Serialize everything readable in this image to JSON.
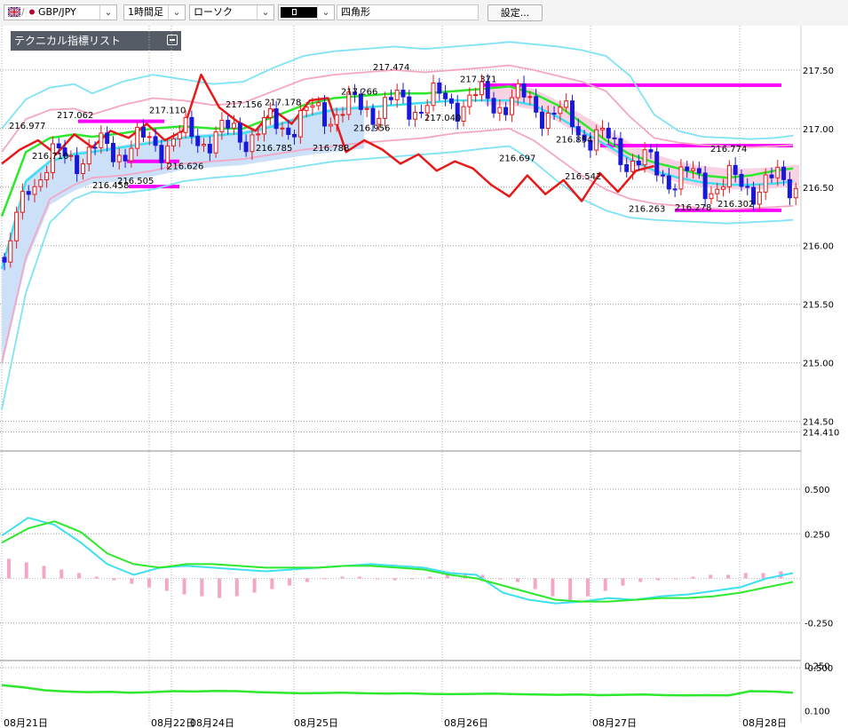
{
  "toolbar": {
    "symbol": "GBP/JPY",
    "timeframe": "1時間足",
    "chart_type": "ローソク",
    "drawing_tool": "四角形",
    "settings_button": "設定..."
  },
  "tech_panel": {
    "title": "テクニカル指標リスト"
  },
  "colors": {
    "bollinger_2": "#f4a6c6",
    "bollinger_3": "#7fe3f5",
    "ma_fast": "#3ee0f0",
    "ma_slow": "#2ee82e",
    "lagging": "#e81818",
    "cloud": "#cce0f8",
    "cloud_bear": "#f8c8dc",
    "level_lines": "#ff00ff",
    "candle_up": "#e81818",
    "candle_down": "#1818d8"
  },
  "chart_data": [
    {
      "type": "line",
      "panel": "price",
      "ylim": [
        214.3,
        217.62
      ],
      "y_ticks": [
        "217.50",
        "217.00",
        "216.50",
        "216.00",
        "215.50",
        "215.00",
        "214.50"
      ],
      "current_price_label": "214.410",
      "x_labels": [
        "08月21日",
        "08月22日",
        "08月24日",
        "08月25日",
        "08月26日",
        "08月27日",
        "08月28日"
      ],
      "annotations": [
        "216.977",
        "216.710",
        "217.062",
        "216.458",
        "216.505",
        "217.110",
        "216.626",
        "217.156",
        "217.178",
        "216.785",
        "216.788",
        "217.266",
        "216.956",
        "217.474",
        "217.040",
        "217.371",
        "216.697",
        "216.854",
        "216.542",
        "216.263",
        "216.278",
        "216.302",
        "216.774"
      ],
      "levels": [
        217.062,
        216.505,
        217.371,
        216.854,
        216.774,
        216.302,
        216.72
      ],
      "series": [
        {
          "key": "bb_upper3",
          "color_key": "bollinger_3",
          "x": [
            0,
            4,
            8,
            12,
            15,
            20,
            25,
            30,
            35,
            40,
            45,
            50,
            55,
            60,
            65,
            70,
            75,
            80,
            84,
            88,
            92,
            96,
            100,
            104,
            108,
            112,
            116,
            120,
            124,
            128,
            131
          ],
          "values": [
            217.0,
            217.25,
            217.35,
            217.38,
            217.3,
            217.4,
            217.46,
            217.42,
            217.38,
            217.4,
            217.52,
            217.62,
            217.66,
            217.68,
            217.7,
            217.68,
            217.7,
            217.72,
            217.74,
            217.72,
            217.7,
            217.67,
            217.62,
            217.45,
            217.12,
            216.98,
            216.93,
            216.92,
            216.91,
            216.92,
            216.94
          ]
        },
        {
          "key": "bb_upper2",
          "color_key": "bollinger_2",
          "x": [
            0,
            4,
            8,
            12,
            15,
            20,
            25,
            30,
            35,
            40,
            45,
            50,
            55,
            60,
            65,
            70,
            75,
            80,
            84,
            88,
            92,
            96,
            100,
            104,
            108,
            112,
            116,
            120,
            124,
            128,
            131
          ],
          "values": [
            216.8,
            217.08,
            217.16,
            217.17,
            217.12,
            217.2,
            217.26,
            217.24,
            217.2,
            217.22,
            217.32,
            217.42,
            217.46,
            217.48,
            217.5,
            217.48,
            217.5,
            217.52,
            217.54,
            217.5,
            217.45,
            217.4,
            217.32,
            217.1,
            216.92,
            216.88,
            216.86,
            216.85,
            216.84,
            216.85,
            216.86
          ]
        },
        {
          "key": "ma_slow",
          "color_key": "ma_slow",
          "x": [
            0,
            4,
            8,
            12,
            15,
            20,
            25,
            30,
            35,
            40,
            45,
            50,
            55,
            60,
            65,
            70,
            75,
            80,
            84,
            88,
            92,
            96,
            100,
            104,
            108,
            112,
            116,
            120,
            124,
            128,
            131
          ],
          "values": [
            216.25,
            216.8,
            216.92,
            216.95,
            216.93,
            216.96,
            217.0,
            217.02,
            217.0,
            217.0,
            217.1,
            217.2,
            217.26,
            217.28,
            217.3,
            217.3,
            217.32,
            217.34,
            217.36,
            217.3,
            217.2,
            217.05,
            216.9,
            216.78,
            216.71,
            216.66,
            216.6,
            216.58,
            216.6,
            216.64,
            216.66
          ]
        },
        {
          "key": "ma_fast",
          "color_key": "ma_fast",
          "x": [
            0,
            4,
            8,
            12,
            15,
            20,
            25,
            30,
            35,
            40,
            45,
            50,
            55,
            60,
            65,
            70,
            75,
            80,
            84,
            88,
            92,
            96,
            100,
            104,
            108,
            112,
            116,
            120,
            124,
            128,
            131
          ],
          "values": [
            215.8,
            216.55,
            216.72,
            216.78,
            216.8,
            216.84,
            216.88,
            216.92,
            216.94,
            216.96,
            217.02,
            217.1,
            217.16,
            217.18,
            217.2,
            217.22,
            217.24,
            217.24,
            217.24,
            217.2,
            217.1,
            216.98,
            216.86,
            216.74,
            216.64,
            216.58,
            216.54,
            216.52,
            216.52,
            216.53,
            216.55
          ]
        },
        {
          "key": "bb_lower2",
          "color_key": "bollinger_2",
          "x": [
            0,
            4,
            8,
            12,
            15,
            20,
            25,
            30,
            35,
            40,
            45,
            50,
            55,
            60,
            65,
            70,
            75,
            80,
            84,
            88,
            92,
            96,
            100,
            104,
            108,
            112,
            116,
            120,
            124,
            128,
            131
          ],
          "values": [
            215.0,
            215.9,
            216.4,
            216.52,
            216.58,
            216.6,
            216.64,
            216.7,
            216.72,
            216.74,
            216.78,
            216.82,
            216.85,
            216.88,
            216.9,
            216.92,
            216.96,
            216.98,
            217.0,
            216.9,
            216.75,
            216.6,
            216.48,
            216.4,
            216.36,
            216.34,
            216.32,
            216.31,
            216.32,
            216.33,
            216.34
          ]
        },
        {
          "key": "bb_lower3",
          "color_key": "bollinger_3",
          "x": [
            0,
            4,
            8,
            12,
            15,
            20,
            25,
            30,
            35,
            40,
            45,
            50,
            55,
            60,
            65,
            70,
            75,
            80,
            84,
            88,
            92,
            96,
            100,
            104,
            108,
            112,
            116,
            120,
            124,
            128,
            131
          ],
          "values": [
            214.6,
            215.6,
            216.2,
            216.4,
            216.46,
            216.45,
            216.48,
            216.55,
            216.58,
            216.6,
            216.64,
            216.68,
            216.72,
            216.74,
            216.76,
            216.78,
            216.8,
            216.83,
            216.85,
            216.72,
            216.55,
            216.4,
            216.3,
            216.24,
            216.22,
            216.21,
            216.2,
            216.19,
            216.2,
            216.21,
            216.22
          ]
        },
        {
          "key": "lagging_span",
          "color_key": "lagging",
          "x": [
            0,
            3,
            6,
            9,
            12,
            15,
            18,
            21,
            24,
            27,
            30,
            33,
            36,
            39,
            42,
            45,
            48,
            51,
            54,
            57,
            60,
            63,
            66,
            69,
            72,
            75,
            78,
            81,
            84,
            87,
            90,
            93,
            96,
            99,
            102,
            105,
            108
          ],
          "values": [
            216.7,
            216.82,
            216.9,
            216.78,
            216.95,
            216.84,
            216.98,
            216.92,
            217.04,
            216.9,
            216.98,
            217.46,
            217.18,
            217.06,
            216.98,
            217.16,
            217.04,
            217.24,
            217.26,
            216.8,
            216.9,
            216.82,
            216.7,
            216.78,
            216.64,
            216.72,
            216.66,
            216.52,
            216.42,
            216.6,
            216.44,
            216.56,
            216.38,
            216.62,
            216.46,
            216.64,
            216.68
          ]
        }
      ]
    },
    {
      "type": "bar",
      "panel": "macd",
      "ylim": [
        -0.52,
        0.52
      ],
      "y_ticks": [
        "0.500",
        "0.250",
        "-0.250",
        "-0.500"
      ],
      "histogram": [
        0.11,
        0.09,
        0.07,
        0.05,
        0.03,
        0.01,
        -0.01,
        -0.03,
        -0.05,
        -0.07,
        -0.09,
        -0.1,
        -0.11,
        -0.1,
        -0.08,
        -0.06,
        -0.04,
        -0.02,
        0.0,
        0.01,
        0.01,
        0.0,
        -0.01,
        0.0,
        0.01,
        0.02,
        0.03,
        0.02,
        0.0,
        -0.02,
        -0.06,
        -0.1,
        -0.12,
        -0.1,
        -0.07,
        -0.04,
        -0.02,
        -0.01,
        0.0,
        0.01,
        0.02,
        0.02,
        0.03,
        0.03,
        0.04
      ],
      "series": [
        {
          "key": "macd",
          "color_key": "ma_fast",
          "values": [
            0.24,
            0.34,
            0.3,
            0.2,
            0.08,
            0.02,
            0.06,
            0.07,
            0.06,
            0.05,
            0.04,
            0.05,
            0.06,
            0.07,
            0.08,
            0.07,
            0.06,
            0.03,
            0.02,
            -0.08,
            -0.12,
            -0.14,
            -0.13,
            -0.11,
            -0.12,
            -0.1,
            -0.09,
            -0.07,
            -0.05,
            0.0,
            0.03
          ]
        },
        {
          "key": "signal",
          "color_key": "ma_slow",
          "values": [
            0.2,
            0.28,
            0.32,
            0.26,
            0.14,
            0.08,
            0.06,
            0.08,
            0.08,
            0.07,
            0.06,
            0.06,
            0.06,
            0.07,
            0.07,
            0.06,
            0.05,
            0.02,
            0.0,
            -0.04,
            -0.08,
            -0.12,
            -0.13,
            -0.13,
            -0.12,
            -0.11,
            -0.11,
            -0.1,
            -0.08,
            -0.05,
            -0.02
          ]
        }
      ]
    },
    {
      "type": "line",
      "panel": "rci",
      "ylim": [
        0.09,
        0.255
      ],
      "y_ticks": [
        "0.250",
        "0.100"
      ],
      "series": [
        {
          "key": "rci",
          "color_key": "ma_slow",
          "values": [
            0.185,
            0.178,
            0.168,
            0.164,
            0.162,
            0.163,
            0.16,
            0.162,
            0.165,
            0.164,
            0.166,
            0.165,
            0.162,
            0.16,
            0.158,
            0.159,
            0.16,
            0.158,
            0.157,
            0.158,
            0.156,
            0.155,
            0.156,
            0.157,
            0.155,
            0.154,
            0.153,
            0.154,
            0.152,
            0.153,
            0.154,
            0.152,
            0.151,
            0.152,
            0.151,
            0.165,
            0.164,
            0.16
          ]
        }
      ]
    }
  ]
}
